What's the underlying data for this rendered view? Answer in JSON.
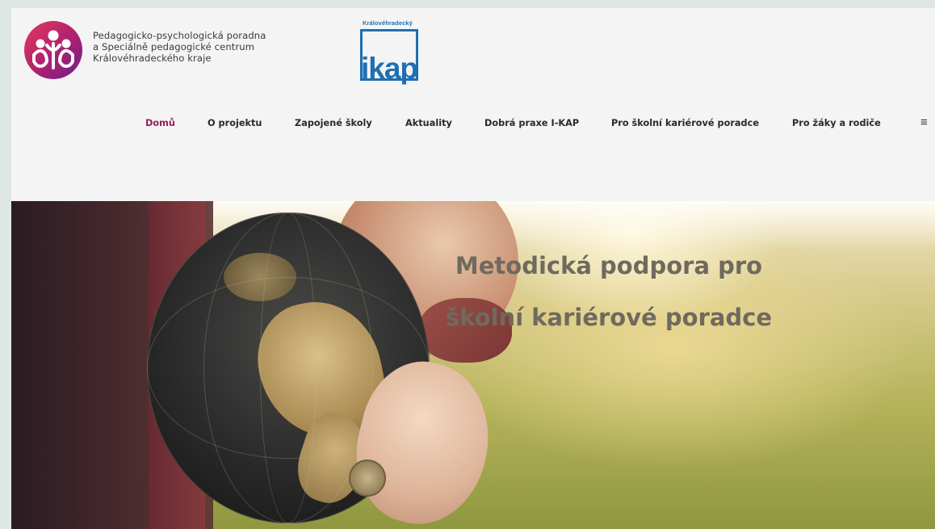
{
  "header": {
    "ppp_lines": [
      "Pedagogicko-psychologická poradna",
      "a Speciálně pedagogické centrum",
      "Královéhradeckého kraje"
    ],
    "ikap_top": "Královéhradecký",
    "ikap_word": "ikap",
    "ppp_logo_icon": "ppp-people-logo-icon"
  },
  "nav": {
    "items": [
      {
        "label": "Domů",
        "active": true
      },
      {
        "label": "O projektu",
        "active": false
      },
      {
        "label": "Zapojené školy",
        "active": false
      },
      {
        "label": "Aktuality",
        "active": false
      },
      {
        "label": "Dobrá praxe I-KAP",
        "active": false
      },
      {
        "label": "Pro školní kariérové poradce",
        "active": false
      },
      {
        "label": "Pro žáky a rodiče",
        "active": false
      }
    ],
    "menu_icon": "≡",
    "active_color": "#9c1a63"
  },
  "hero": {
    "title_line1": "Metodická podpora pro",
    "title_line2": "školní kariérové poradce"
  },
  "colors": {
    "ikap_blue": "#1f6fb2",
    "nav_text": "#2a2a2a",
    "hero_text": "#6f6a5e"
  }
}
